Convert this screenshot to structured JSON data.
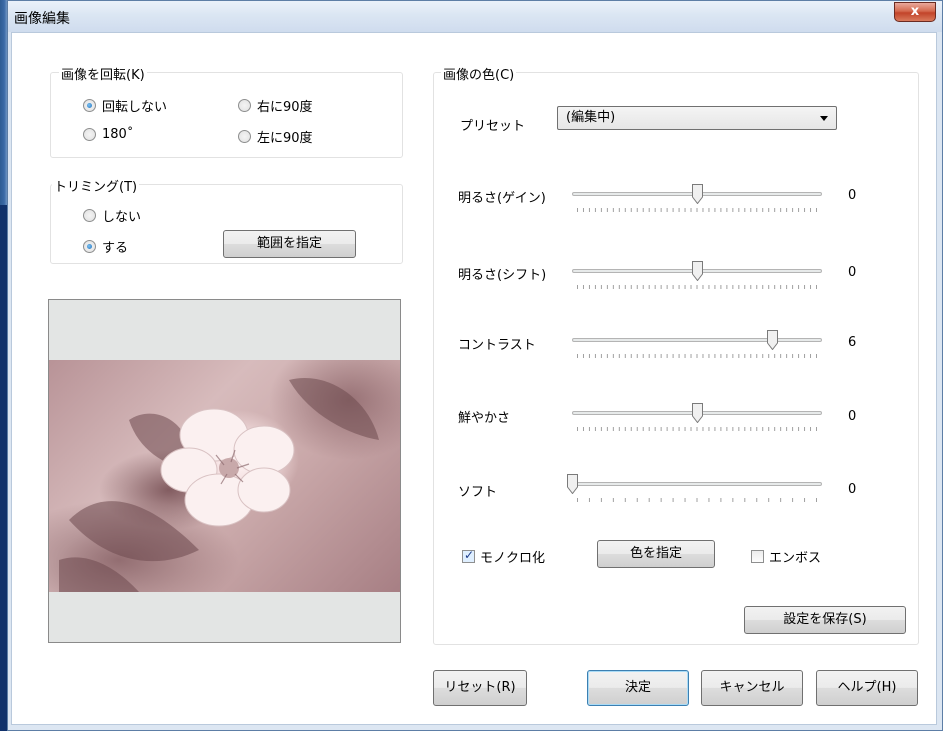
{
  "window": {
    "title": "画像編集",
    "close_label": "x"
  },
  "rotate": {
    "label": "画像を回転(K)",
    "options": [
      {
        "label": "回転しない",
        "selected": true
      },
      {
        "label": "右に90度",
        "selected": false
      },
      {
        "label": "180˚",
        "selected": false
      },
      {
        "label": "左に90度",
        "selected": false
      }
    ]
  },
  "trim": {
    "label": "トリミング(T)",
    "options": [
      {
        "label": "しない",
        "selected": false
      },
      {
        "label": "する",
        "selected": true
      }
    ],
    "range_button": "範囲を指定"
  },
  "color": {
    "label": "画像の色(C)",
    "preset_label": "プリセット",
    "preset_value": "(編集中)",
    "sliders": [
      {
        "label": "明るさ(ゲイン)",
        "value": "0",
        "min": -10,
        "max": 10,
        "pos": 0
      },
      {
        "label": "明るさ(シフト)",
        "value": "0",
        "min": -10,
        "max": 10,
        "pos": 0
      },
      {
        "label": "コントラスト",
        "value": "6",
        "min": -10,
        "max": 10,
        "pos": 6
      },
      {
        "label": "鮮やかさ",
        "value": "0",
        "min": -10,
        "max": 10,
        "pos": 0
      },
      {
        "label": "ソフト",
        "value": "0",
        "min": 0,
        "max": 10,
        "pos": 0
      }
    ],
    "mono_label": "モノクロ化",
    "mono_checked": true,
    "color_button": "色を指定",
    "emboss_label": "エンボス",
    "emboss_checked": false,
    "save_button": "設定を保存(S)"
  },
  "footer": {
    "reset": "リセット(R)",
    "ok": "決定",
    "cancel": "キャンセル",
    "help": "ヘルプ(H)"
  },
  "colors": {
    "accent": "#1d6fbd",
    "photo_tint": "#c9a7a9"
  }
}
